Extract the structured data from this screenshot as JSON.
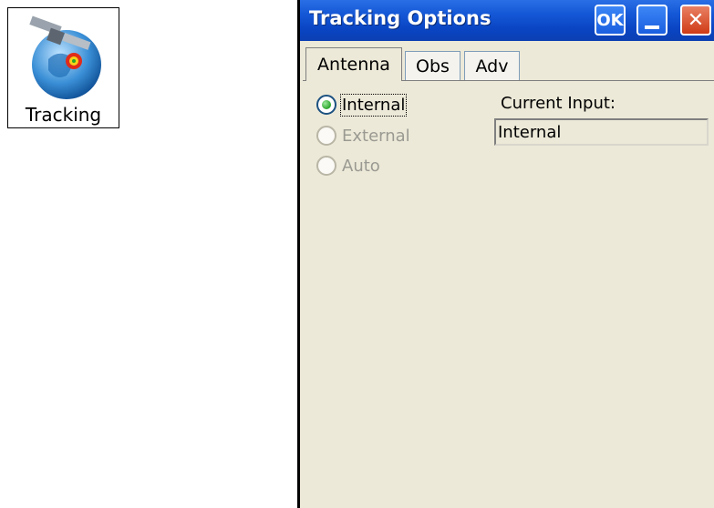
{
  "desktop": {
    "app_icon": {
      "icon": "satellite-globe-icon",
      "label": "Tracking"
    }
  },
  "window": {
    "title": "Tracking Options",
    "buttons": {
      "ok": "OK",
      "minimize": "minimize",
      "close": "✕"
    },
    "colors": {
      "titlebar": "#0b45c6",
      "close": "#d9461f",
      "body": "#ece9d8"
    },
    "tabs": [
      {
        "label": "Antenna",
        "active": true
      },
      {
        "label": "Obs",
        "active": false
      },
      {
        "label": "Adv",
        "active": false
      }
    ],
    "antenna": {
      "options": [
        {
          "label": "Internal",
          "selected": true,
          "enabled": true
        },
        {
          "label": "External",
          "selected": false,
          "enabled": false
        },
        {
          "label": "Auto",
          "selected": false,
          "enabled": false
        }
      ],
      "current_input_label": "Current Input:",
      "current_input_value": "Internal"
    }
  }
}
